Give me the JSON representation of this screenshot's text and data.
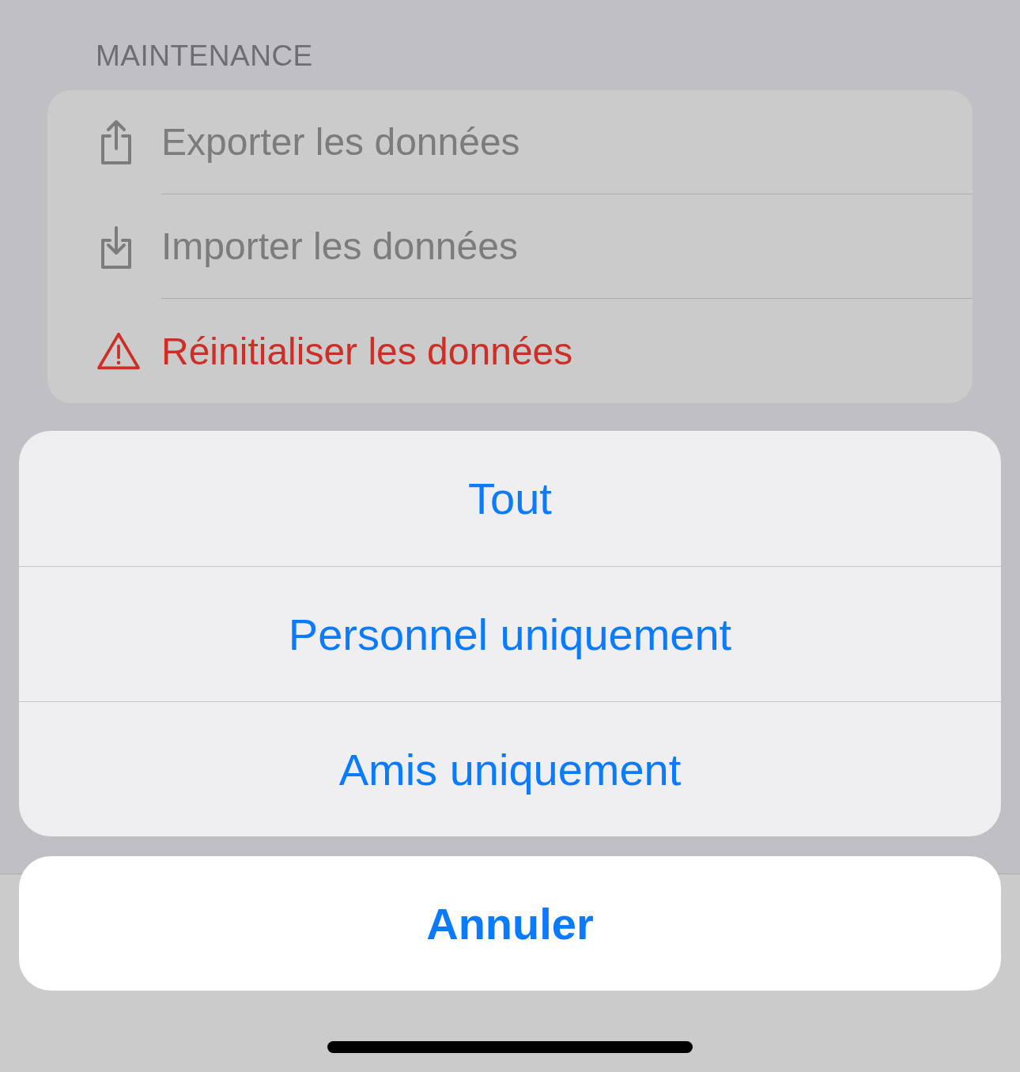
{
  "section": {
    "header": "MAINTENANCE",
    "rows": [
      {
        "label": "Exporter les données",
        "kind": "normal"
      },
      {
        "label": "Importer les données",
        "kind": "normal"
      },
      {
        "label": "Réinitialiser les données",
        "kind": "destructive"
      }
    ]
  },
  "action_sheet": {
    "options": [
      "Tout",
      "Personnel uniquement",
      "Amis uniquement"
    ],
    "cancel": "Annuler"
  }
}
